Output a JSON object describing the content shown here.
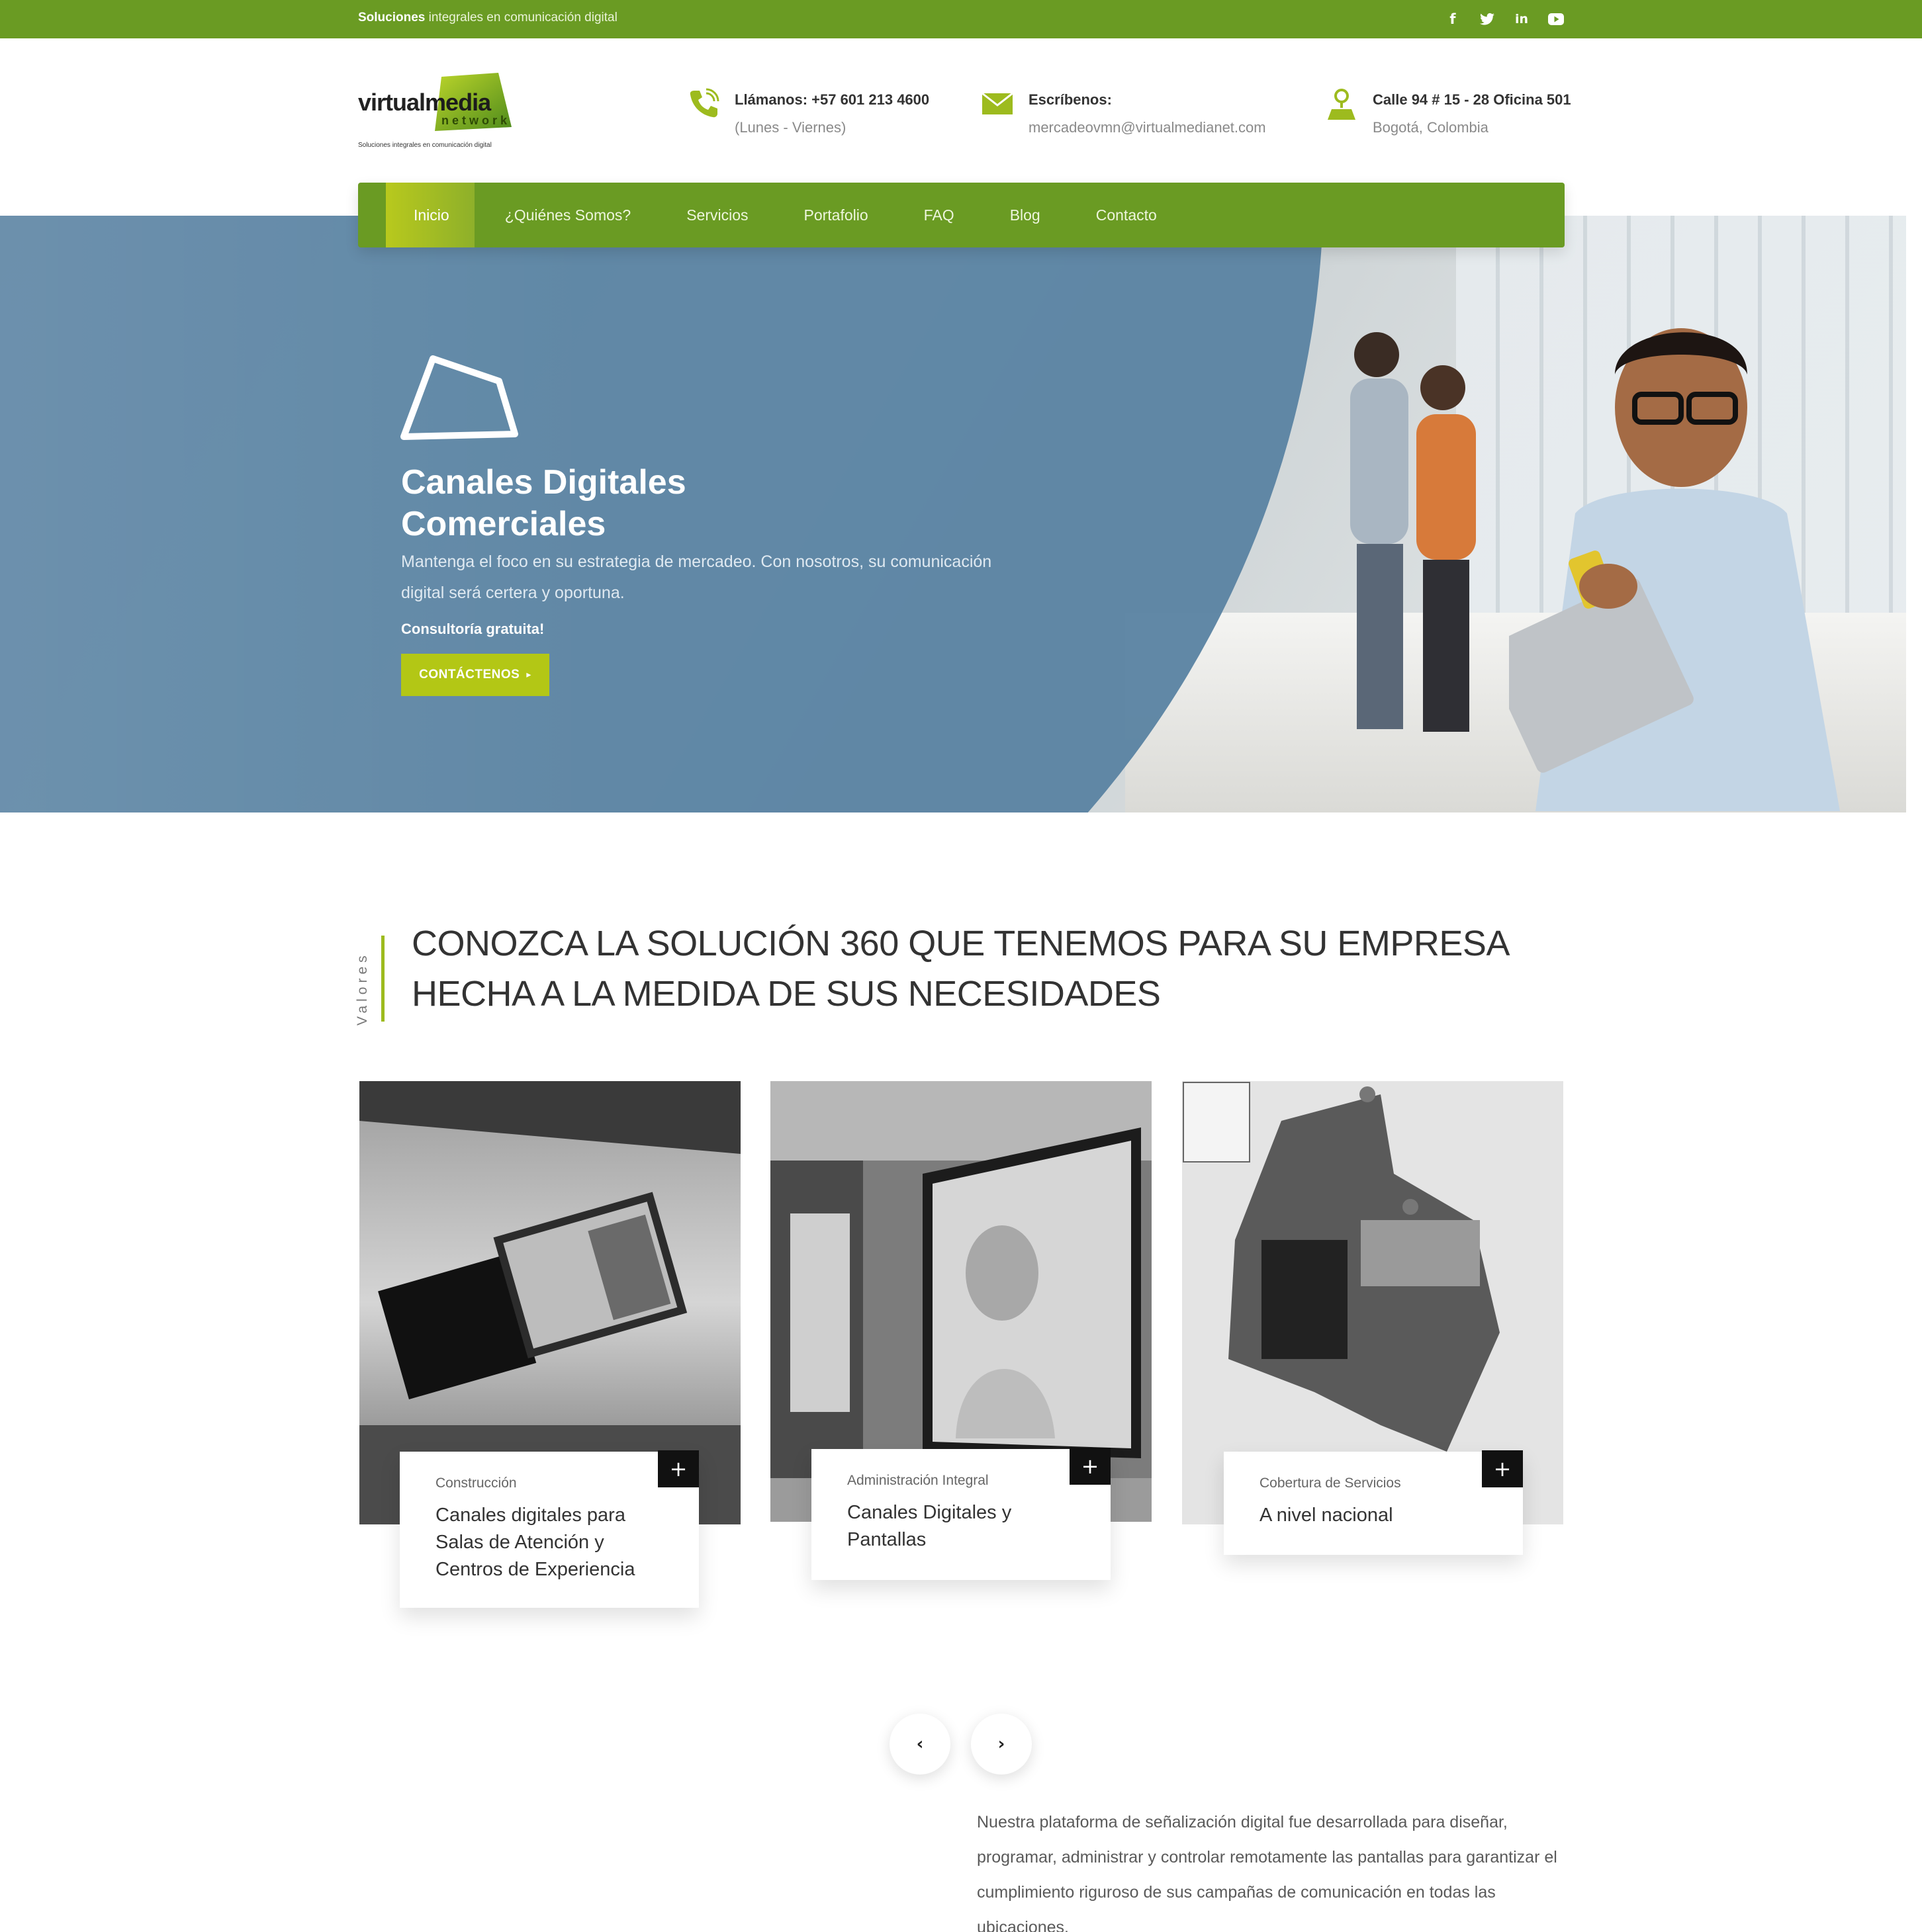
{
  "topbar": {
    "tagline_bold": "Soluciones",
    "tagline_rest": " integrales en comunicación digital",
    "social": [
      {
        "icon": "facebook-icon",
        "glyph": "f"
      },
      {
        "icon": "twitter-icon",
        "glyph": "🐦"
      },
      {
        "icon": "linkedin-icon",
        "glyph": "in"
      },
      {
        "icon": "youtube-icon",
        "glyph": "▶"
      }
    ]
  },
  "logo": {
    "word_start": "virtual",
    "word_end": "media",
    "network": "network",
    "subtitle": "Soluciones integrales en comunicación digital"
  },
  "contact": {
    "phone": {
      "label": "Llámanos: +57 601 213 4600",
      "hours": "(Lunes - Viernes)"
    },
    "mail": {
      "label": "Escríbenos:",
      "email": "mercadeovmn@virtualmedianet.com"
    },
    "address": {
      "line1": "Calle 94 # 15 - 28 Oficina 501",
      "line2": "Bogotá, Colombia"
    }
  },
  "nav": {
    "items": [
      "Inicio",
      "¿Quiénes Somos?",
      "Servicios",
      "Portafolio",
      "FAQ",
      "Blog",
      "Contacto"
    ]
  },
  "hero": {
    "title": "Canales Digitales Comerciales",
    "description": "Mantenga el foco en su estrategia de mercadeo. Con nosotros, su comunicación digital será certera y oportuna.",
    "cta_title": "Consultoría gratuita!",
    "cta_label": "CONTÁCTENOS",
    "cta_arrow": "▸"
  },
  "section": {
    "vertical_label": "Valores",
    "headline": "CONOZCA LA SOLUCIÓN 360 QUE TENEMOS PARA SU EMPRESA HECHA A LA MEDIDA DE SUS NECESIDADES"
  },
  "cards": [
    {
      "category": "Construcción",
      "title": "Canales digitales para Salas de Atención y Centros de Experiencia",
      "plus": "+"
    },
    {
      "category": "Administración Integral",
      "title": "Canales Digitales y Pantallas",
      "plus": "+"
    },
    {
      "category": "Cobertura de Servicios",
      "title": "A nivel nacional",
      "plus": "+"
    }
  ],
  "carousel": {
    "prev": "‹",
    "next": "›"
  },
  "body_text": "Nuestra plataforma de señalización digital fue desarrollada para  diseñar, programar, administrar y controlar remotamente las pantallas para garantizar el cumplimiento riguroso de sus campañas de comunicación en todas las ubicaciones.",
  "colors": {
    "brand_green": "#6a9b23",
    "accent_lime": "#b3c715",
    "hero_blue": "#5c84a3"
  }
}
